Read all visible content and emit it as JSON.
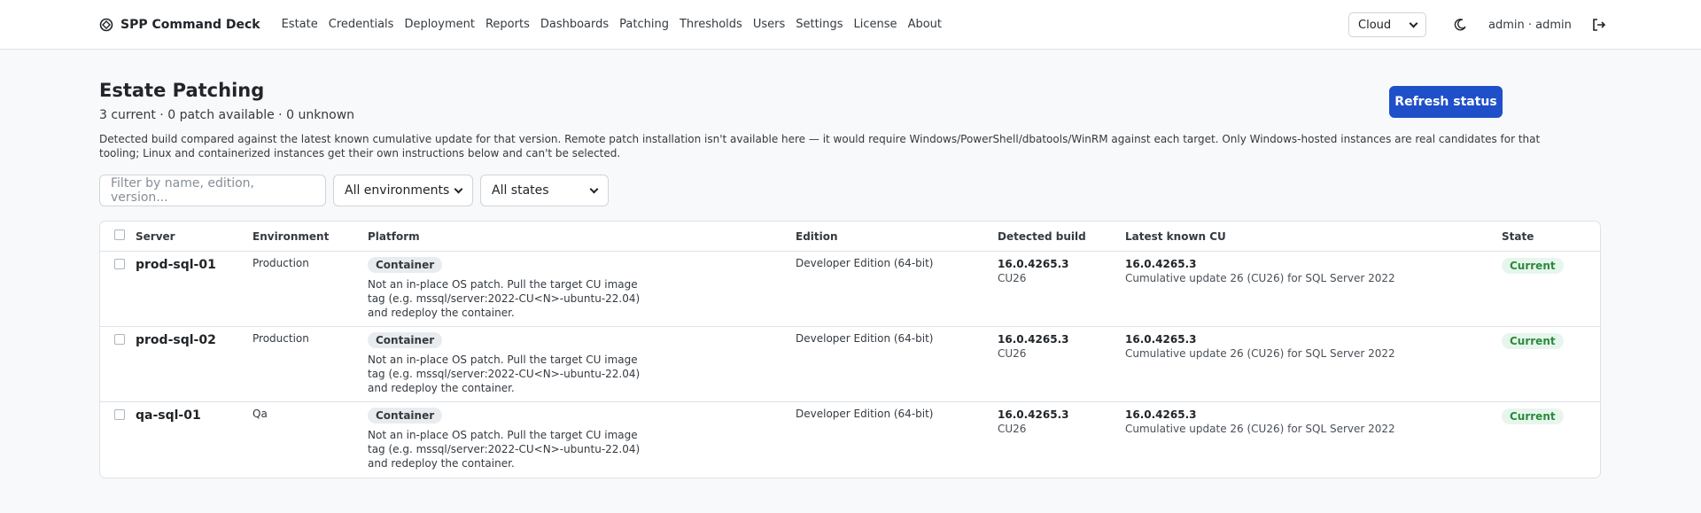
{
  "app": {
    "brand": "SPP Command Deck",
    "nav": [
      "Estate",
      "Credentials",
      "Deployment",
      "Reports",
      "Dashboards",
      "Patching",
      "Thresholds",
      "Users",
      "Settings",
      "License",
      "About"
    ],
    "cloud_select": "Cloud",
    "user": "admin · admin"
  },
  "page": {
    "title": "Estate Patching",
    "refresh_label": "Refresh status",
    "summary": "3 current · 0 patch available · 0 unknown",
    "description": "Detected build compared against the latest known cumulative update for that version. Remote patch installation isn't available here — it would require Windows/PowerShell/dbatools/WinRM against each target. Only Windows-hosted instances are real candidates for that tooling; Linux and containerized instances get their own instructions below and can't be selected."
  },
  "filters": {
    "search_placeholder": "Filter by name, edition, version...",
    "environment": "All environments",
    "state": "All states"
  },
  "table": {
    "headers": [
      "Server",
      "Environment",
      "Platform",
      "Edition",
      "Detected build",
      "Latest known CU",
      "State"
    ],
    "rows": [
      {
        "server": "prod-sql-01",
        "environment": "Production",
        "platform": "Container",
        "note": "Not an in-place OS patch. Pull the target CU image tag (e.g. mssql/server:2022-CU<N>-ubuntu-22.04) and redeploy the container.",
        "edition": "Developer Edition (64-bit)",
        "build": "16.0.4265.3",
        "build_cu": "CU26",
        "latest": "16.0.4265.3",
        "latest_desc": "Cumulative update 26 (CU26) for SQL Server 2022",
        "state": "Current"
      },
      {
        "server": "prod-sql-02",
        "environment": "Production",
        "platform": "Container",
        "note": "Not an in-place OS patch. Pull the target CU image tag (e.g. mssql/server:2022-CU<N>-ubuntu-22.04) and redeploy the container.",
        "edition": "Developer Edition (64-bit)",
        "build": "16.0.4265.3",
        "build_cu": "CU26",
        "latest": "16.0.4265.3",
        "latest_desc": "Cumulative update 26 (CU26) for SQL Server 2022",
        "state": "Current"
      },
      {
        "server": "qa-sql-01",
        "environment": "Qa",
        "platform": "Container",
        "note": "Not an in-place OS patch. Pull the target CU image tag (e.g. mssql/server:2022-CU<N>-ubuntu-22.04) and redeploy the container.",
        "edition": "Developer Edition (64-bit)",
        "build": "16.0.4265.3",
        "build_cu": "CU26",
        "latest": "16.0.4265.3",
        "latest_desc": "Cumulative update 26 (CU26) for SQL Server 2022",
        "state": "Current"
      }
    ]
  },
  "icons": {
    "brand": "logo-icon",
    "theme": "moon-icon",
    "logout": "logout-icon"
  },
  "colors": {
    "primary": "#1f4fc9",
    "success_text": "#2b8a3e",
    "success_bg": "#e7f6ec"
  }
}
